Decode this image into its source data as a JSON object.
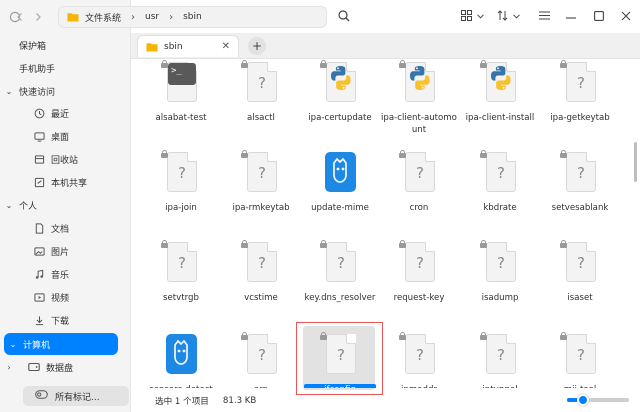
{
  "breadcrumb": {
    "segments": [
      "文件系统",
      "usr",
      "sbin"
    ]
  },
  "tab": {
    "title": "sbin"
  },
  "sidebar": {
    "top": [
      {
        "label": "保护箱"
      },
      {
        "label": "手机助手"
      }
    ],
    "groups": [
      {
        "label": "快速访问",
        "items": [
          {
            "label": "最近",
            "icon": "clock-icon"
          },
          {
            "label": "桌面",
            "icon": "desktop-icon"
          },
          {
            "label": "回收站",
            "icon": "trash-icon"
          },
          {
            "label": "本机共享",
            "icon": "share-icon"
          }
        ]
      },
      {
        "label": "个人",
        "items": [
          {
            "label": "文档",
            "icon": "document-icon"
          },
          {
            "label": "图片",
            "icon": "picture-icon"
          },
          {
            "label": "音乐",
            "icon": "music-icon"
          },
          {
            "label": "视频",
            "icon": "video-icon"
          },
          {
            "label": "下载",
            "icon": "download-icon"
          }
        ]
      },
      {
        "label": "计算机",
        "active": true,
        "items": [
          {
            "label": "数据盘",
            "icon": "disk-icon"
          }
        ]
      }
    ],
    "bottom": {
      "label": "所有标记..."
    }
  },
  "files": [
    {
      "name": "alsabat-test",
      "icon": "terminal"
    },
    {
      "name": "alsactl",
      "icon": "unknown"
    },
    {
      "name": "ipa-certupdate",
      "icon": "python"
    },
    {
      "name": "ipa-client-automount",
      "icon": "python"
    },
    {
      "name": "ipa-client-install",
      "icon": "python"
    },
    {
      "name": "ipa-getkeytab",
      "icon": "unknown"
    },
    {
      "name": "ipa-join",
      "icon": "unknown"
    },
    {
      "name": "ipa-rmkeytab",
      "icon": "unknown"
    },
    {
      "name": "update-mime",
      "icon": "app"
    },
    {
      "name": "cron",
      "icon": "unknown"
    },
    {
      "name": "kbdrate",
      "icon": "unknown"
    },
    {
      "name": "setvesablank",
      "icon": "unknown"
    },
    {
      "name": "setvtrgb",
      "icon": "unknown"
    },
    {
      "name": "vcstime",
      "icon": "unknown"
    },
    {
      "name": "key.dns_resolver",
      "icon": "unknown"
    },
    {
      "name": "request-key",
      "icon": "unknown"
    },
    {
      "name": "isadump",
      "icon": "unknown"
    },
    {
      "name": "isaset",
      "icon": "unknown"
    },
    {
      "name": "sensors-detect",
      "icon": "app"
    },
    {
      "name": "arp",
      "icon": "unknown"
    },
    {
      "name": "ifconfig",
      "icon": "unknown",
      "selected": true
    },
    {
      "name": "ipmaddr",
      "icon": "unknown"
    },
    {
      "name": "iptunnel",
      "icon": "unknown"
    },
    {
      "name": "mii-tool",
      "icon": "unknown"
    }
  ],
  "status": {
    "text": "选中 1 个项目",
    "size": "81.3 KB"
  },
  "zoom": {
    "level": 0.25
  },
  "colors": {
    "accent": "#0081ff",
    "selection_outline": "#e55555"
  }
}
